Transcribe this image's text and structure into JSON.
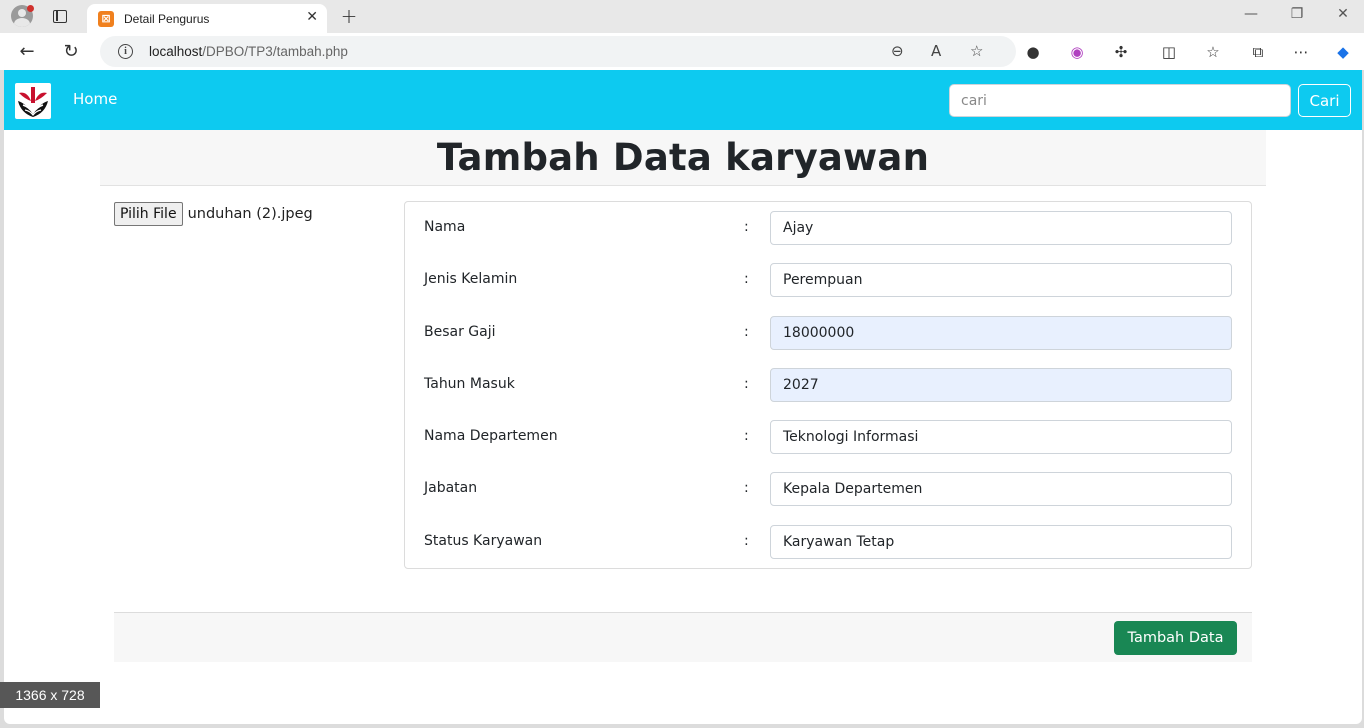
{
  "browser": {
    "tab_title": "Detail Pengurus",
    "url_host": "localhost",
    "url_path": "/DPBO/TP3/tambah.php",
    "accent_color": "#0dcaf0"
  },
  "navbar": {
    "home_label": "Home",
    "search_placeholder": "cari",
    "search_button": "Cari"
  },
  "page": {
    "title": "Tambah Data karyawan",
    "file_button": "Pilih File",
    "file_name": "unduhan (2).jpeg",
    "submit_button": "Tambah Data",
    "submit_color": "#198754"
  },
  "form": {
    "colon": ":",
    "fields": [
      {
        "label": "Nama",
        "value": "Ajay"
      },
      {
        "label": "Jenis Kelamin",
        "value": "Perempuan"
      },
      {
        "label": "Besar Gaji",
        "value": "18000000"
      },
      {
        "label": "Tahun Masuk",
        "value": "2027"
      },
      {
        "label": "Nama Departemen",
        "value": "Teknologi Informasi"
      },
      {
        "label": "Jabatan",
        "value": "Kepala Departemen"
      },
      {
        "label": "Status Karyawan",
        "value": "Karyawan Tetap"
      }
    ]
  },
  "overlay": {
    "size_badge": "1366 x 728"
  }
}
